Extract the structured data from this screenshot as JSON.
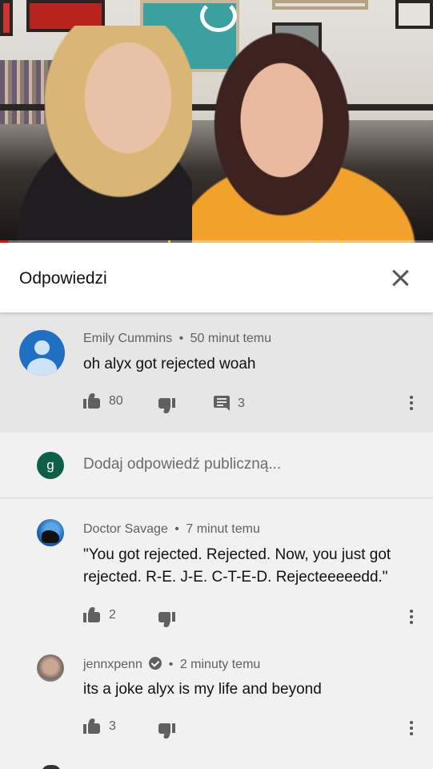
{
  "video": {
    "loading": true,
    "progress_played_percent": 1.8,
    "accent_color": "#ff0000"
  },
  "replies_panel": {
    "title": "Odpowiedzi",
    "close_icon": "close-icon"
  },
  "parent_comment": {
    "author": "Emily Cummins",
    "separator": "•",
    "time": "50 minut temu",
    "text": "oh alyx got rejected woah",
    "likes": "80",
    "replies": "3"
  },
  "add_reply": {
    "avatar_letter": "g",
    "placeholder": "Dodaj odpowiedź publiczną..."
  },
  "replies": [
    {
      "author": "Doctor Savage",
      "separator": "•",
      "time": "7 minut temu",
      "text_line1": "\"You got rejected. Rejected. Now, you just got",
      "text_line2": "rejected. R-E. J-E. C-T-E-D. Rejecteeeeedd.\"",
      "likes": "2",
      "verified": false
    },
    {
      "author": "jennxpenn",
      "separator": "•",
      "time": "2 minuty temu",
      "text": "its a joke alyx is my life and beyond",
      "likes": "3",
      "verified": true
    }
  ]
}
